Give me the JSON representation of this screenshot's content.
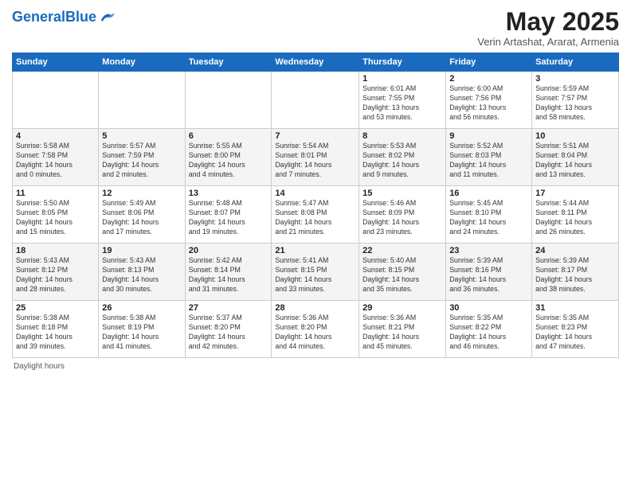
{
  "header": {
    "logo_general": "General",
    "logo_blue": "Blue",
    "title": "May 2025",
    "subtitle": "Verin Artashat, Ararat, Armenia"
  },
  "days_of_week": [
    "Sunday",
    "Monday",
    "Tuesday",
    "Wednesday",
    "Thursday",
    "Friday",
    "Saturday"
  ],
  "weeks": [
    [
      {
        "day": "",
        "info": ""
      },
      {
        "day": "",
        "info": ""
      },
      {
        "day": "",
        "info": ""
      },
      {
        "day": "",
        "info": ""
      },
      {
        "day": "1",
        "info": "Sunrise: 6:01 AM\nSunset: 7:55 PM\nDaylight: 13 hours\nand 53 minutes."
      },
      {
        "day": "2",
        "info": "Sunrise: 6:00 AM\nSunset: 7:56 PM\nDaylight: 13 hours\nand 56 minutes."
      },
      {
        "day": "3",
        "info": "Sunrise: 5:59 AM\nSunset: 7:57 PM\nDaylight: 13 hours\nand 58 minutes."
      }
    ],
    [
      {
        "day": "4",
        "info": "Sunrise: 5:58 AM\nSunset: 7:58 PM\nDaylight: 14 hours\nand 0 minutes."
      },
      {
        "day": "5",
        "info": "Sunrise: 5:57 AM\nSunset: 7:59 PM\nDaylight: 14 hours\nand 2 minutes."
      },
      {
        "day": "6",
        "info": "Sunrise: 5:55 AM\nSunset: 8:00 PM\nDaylight: 14 hours\nand 4 minutes."
      },
      {
        "day": "7",
        "info": "Sunrise: 5:54 AM\nSunset: 8:01 PM\nDaylight: 14 hours\nand 7 minutes."
      },
      {
        "day": "8",
        "info": "Sunrise: 5:53 AM\nSunset: 8:02 PM\nDaylight: 14 hours\nand 9 minutes."
      },
      {
        "day": "9",
        "info": "Sunrise: 5:52 AM\nSunset: 8:03 PM\nDaylight: 14 hours\nand 11 minutes."
      },
      {
        "day": "10",
        "info": "Sunrise: 5:51 AM\nSunset: 8:04 PM\nDaylight: 14 hours\nand 13 minutes."
      }
    ],
    [
      {
        "day": "11",
        "info": "Sunrise: 5:50 AM\nSunset: 8:05 PM\nDaylight: 14 hours\nand 15 minutes."
      },
      {
        "day": "12",
        "info": "Sunrise: 5:49 AM\nSunset: 8:06 PM\nDaylight: 14 hours\nand 17 minutes."
      },
      {
        "day": "13",
        "info": "Sunrise: 5:48 AM\nSunset: 8:07 PM\nDaylight: 14 hours\nand 19 minutes."
      },
      {
        "day": "14",
        "info": "Sunrise: 5:47 AM\nSunset: 8:08 PM\nDaylight: 14 hours\nand 21 minutes."
      },
      {
        "day": "15",
        "info": "Sunrise: 5:46 AM\nSunset: 8:09 PM\nDaylight: 14 hours\nand 23 minutes."
      },
      {
        "day": "16",
        "info": "Sunrise: 5:45 AM\nSunset: 8:10 PM\nDaylight: 14 hours\nand 24 minutes."
      },
      {
        "day": "17",
        "info": "Sunrise: 5:44 AM\nSunset: 8:11 PM\nDaylight: 14 hours\nand 26 minutes."
      }
    ],
    [
      {
        "day": "18",
        "info": "Sunrise: 5:43 AM\nSunset: 8:12 PM\nDaylight: 14 hours\nand 28 minutes."
      },
      {
        "day": "19",
        "info": "Sunrise: 5:43 AM\nSunset: 8:13 PM\nDaylight: 14 hours\nand 30 minutes."
      },
      {
        "day": "20",
        "info": "Sunrise: 5:42 AM\nSunset: 8:14 PM\nDaylight: 14 hours\nand 31 minutes."
      },
      {
        "day": "21",
        "info": "Sunrise: 5:41 AM\nSunset: 8:15 PM\nDaylight: 14 hours\nand 33 minutes."
      },
      {
        "day": "22",
        "info": "Sunrise: 5:40 AM\nSunset: 8:15 PM\nDaylight: 14 hours\nand 35 minutes."
      },
      {
        "day": "23",
        "info": "Sunrise: 5:39 AM\nSunset: 8:16 PM\nDaylight: 14 hours\nand 36 minutes."
      },
      {
        "day": "24",
        "info": "Sunrise: 5:39 AM\nSunset: 8:17 PM\nDaylight: 14 hours\nand 38 minutes."
      }
    ],
    [
      {
        "day": "25",
        "info": "Sunrise: 5:38 AM\nSunset: 8:18 PM\nDaylight: 14 hours\nand 39 minutes."
      },
      {
        "day": "26",
        "info": "Sunrise: 5:38 AM\nSunset: 8:19 PM\nDaylight: 14 hours\nand 41 minutes."
      },
      {
        "day": "27",
        "info": "Sunrise: 5:37 AM\nSunset: 8:20 PM\nDaylight: 14 hours\nand 42 minutes."
      },
      {
        "day": "28",
        "info": "Sunrise: 5:36 AM\nSunset: 8:20 PM\nDaylight: 14 hours\nand 44 minutes."
      },
      {
        "day": "29",
        "info": "Sunrise: 5:36 AM\nSunset: 8:21 PM\nDaylight: 14 hours\nand 45 minutes."
      },
      {
        "day": "30",
        "info": "Sunrise: 5:35 AM\nSunset: 8:22 PM\nDaylight: 14 hours\nand 46 minutes."
      },
      {
        "day": "31",
        "info": "Sunrise: 5:35 AM\nSunset: 8:23 PM\nDaylight: 14 hours\nand 47 minutes."
      }
    ]
  ],
  "footer": {
    "label": "Daylight hours"
  }
}
